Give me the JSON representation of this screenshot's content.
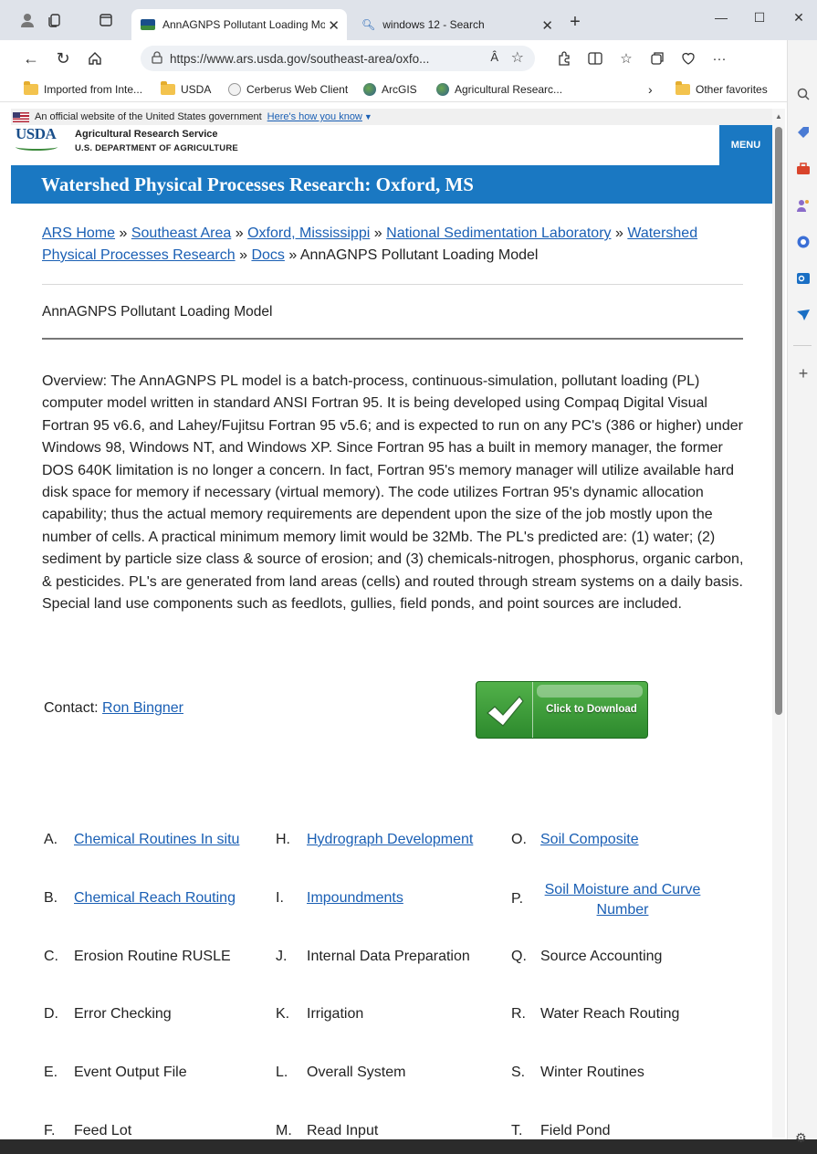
{
  "browser": {
    "tabs": [
      {
        "title": "AnnAGNPS Pollutant Loading Mo",
        "active": true
      },
      {
        "title": "windows 12 - Search",
        "active": false
      }
    ],
    "url": "https://www.ars.usda.gov/southeast-area/oxfo...",
    "read_aloud": "Â",
    "favorites": [
      {
        "label": "Imported from Inte...",
        "icon": "folder-icon"
      },
      {
        "label": "USDA",
        "icon": "folder-icon"
      },
      {
        "label": "Cerberus Web Client",
        "icon": "cerberus-icon"
      },
      {
        "label": "ArcGIS",
        "icon": "globe-icon"
      },
      {
        "label": "Agricultural Researc...",
        "icon": "globe-icon"
      }
    ],
    "other_favorites": "Other favorites"
  },
  "site": {
    "gov_banner": "An official website of the United States government",
    "gov_banner_link": "Here's how you know",
    "logo": "USDA",
    "agency_name": "Agricultural Research Service",
    "agency_dept": "U.S. DEPARTMENT OF AGRICULTURE",
    "menu": "MENU",
    "page_title": "Watershed Physical Processes Research: Oxford, MS"
  },
  "breadcrumb": {
    "items": [
      {
        "label": "ARS Home",
        "link": true
      },
      {
        "label": "Southeast Area",
        "link": true
      },
      {
        "label": "Oxford, Mississippi",
        "link": true
      },
      {
        "label": "National Sedimentation Laboratory",
        "link": true
      },
      {
        "label": "Watershed Physical Processes Research",
        "link": true
      },
      {
        "label": "Docs",
        "link": true
      },
      {
        "label": "AnnAGNPS Pollutant Loading Model",
        "link": false
      }
    ],
    "separator": "»"
  },
  "doc": {
    "title": "AnnAGNPS Pollutant Loading Model",
    "overview": "Overview: The AnnAGNPS PL model is a batch-process, continuous-simulation, pollutant loading (PL) computer model written in standard ANSI Fortran 95. It is being developed using Compaq Digital Visual Fortran 95 v6.6, and Lahey/Fujitsu Fortran 95 v5.6; and is expected to run on any PC's (386 or higher) under Windows 98, Windows NT, and Windows XP. Since Fortran 95 has a built in memory manager, the former DOS 640K limitation is no longer a concern. In fact, Fortran 95's memory manager will utilize available hard disk space for memory if necessary (virtual memory). The code utilizes Fortran 95's dynamic allocation capability; thus the actual memory requirements are dependent upon the size of the job mostly upon the number of cells. A practical minimum memory limit would be 32Mb. The PL's predicted are: (1) water; (2) sediment by particle size class & source of erosion; and (3) chemicals-nitrogen, phosphorus, organic carbon, & pesticides. PL's are generated from land areas (cells) and routed through stream systems on a daily basis. Special land use components such as feedlots, gullies, field ponds, and point sources are included.",
    "contact_label": "Contact:",
    "contact_name": "Ron Bingner",
    "download_label": "Click to Download"
  },
  "index": {
    "col1": [
      {
        "letter": "A.",
        "label": "Chemical Routines In situ",
        "link": true
      },
      {
        "letter": "B.",
        "label": "Chemical Reach Routing",
        "link": true
      },
      {
        "letter": "C.",
        "label": "Erosion Routine RUSLE",
        "link": false
      },
      {
        "letter": "D.",
        "label": "Error Checking",
        "link": false
      },
      {
        "letter": "E.",
        "label": "Event Output File",
        "link": false
      },
      {
        "letter": "F.",
        "label": "Feed Lot",
        "link": false
      }
    ],
    "col2": [
      {
        "letter": "H.",
        "label": "Hydrograph Development",
        "link": true
      },
      {
        "letter": "I.",
        "label": "Impoundments",
        "link": true
      },
      {
        "letter": "J.",
        "label": "Internal Data Preparation",
        "link": false
      },
      {
        "letter": "K.",
        "label": "Irrigation",
        "link": false
      },
      {
        "letter": "L.",
        "label": "Overall System",
        "link": false
      },
      {
        "letter": "M.",
        "label": "Read Input",
        "link": false
      }
    ],
    "col3": [
      {
        "letter": "O.",
        "label": "Soil Composite",
        "link": true
      },
      {
        "letter": "P.",
        "label": "Soil Moisture and Curve Number",
        "link": true
      },
      {
        "letter": "Q.",
        "label": "Source Accounting",
        "link": false
      },
      {
        "letter": "R.",
        "label": "Water Reach Routing",
        "link": false
      },
      {
        "letter": "S.",
        "label": "Winter Routines",
        "link": false
      },
      {
        "letter": "T.",
        "label": "Field Pond",
        "link": false
      }
    ]
  }
}
